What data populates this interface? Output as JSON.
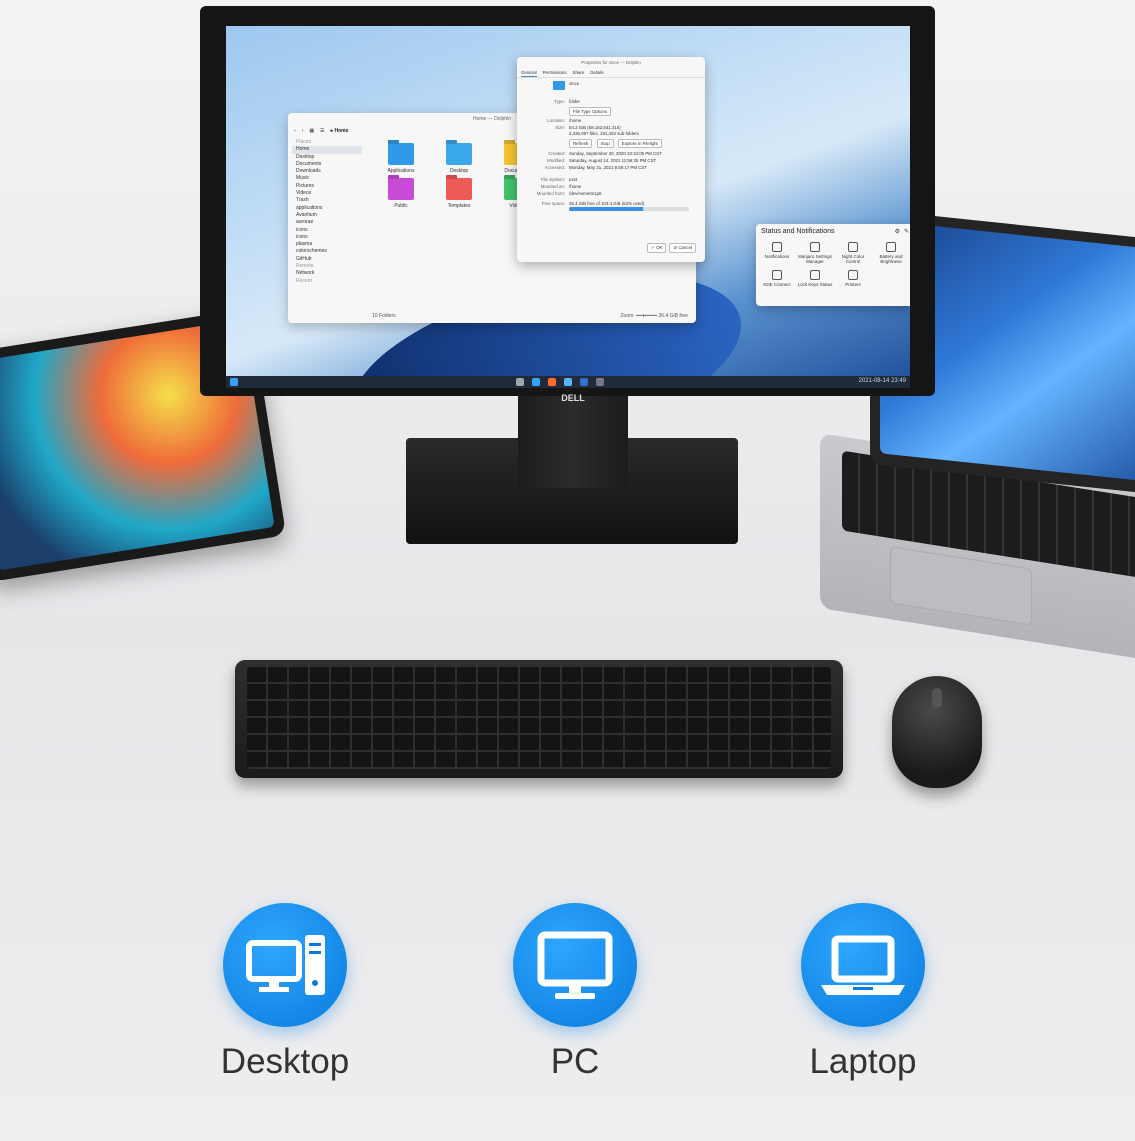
{
  "colors": {
    "accent_blue": "#0a7bdc",
    "badge_blue": "#2ea6ff",
    "keyboard": "#1b1b1b"
  },
  "monitor": {
    "brand": "DELL",
    "dolphin": {
      "title": "Home — Dolphin",
      "breadcrumb": "Home",
      "places_heading": "Places",
      "places": [
        "Home",
        "Desktop",
        "Documents",
        "Downloads",
        "Music",
        "Pictures",
        "Videos",
        "Trash",
        "applications",
        "Avantium",
        "aurorae",
        "icons",
        "icons",
        "plasma",
        "colorschemes",
        "GitHub"
      ],
      "remote_heading": "Remote",
      "remote": [
        "Network"
      ],
      "recent_heading": "Recent",
      "folders": [
        {
          "name": "Applications",
          "color": "#2f9be8"
        },
        {
          "name": "Desktop",
          "color": "#3aa7e9"
        },
        {
          "name": "Documents",
          "color": "#f4c431"
        },
        {
          "name": "Public",
          "color": "#c84bd6"
        },
        {
          "name": "Templates",
          "color": "#ee5a57"
        },
        {
          "name": "Videos",
          "color": "#41c26b"
        }
      ],
      "status": "10 Folders",
      "zoom_label": "Zoom:",
      "free": "36.4 GiB free"
    },
    "properties": {
      "title": "Properties for vince — Dolphin",
      "tabs": [
        "General",
        "Permissions",
        "Share",
        "Details"
      ],
      "name": "vince",
      "type_label": "Type:",
      "type_value": "folder",
      "file_type_options": "File Type Options",
      "location_label": "Location:",
      "location_value": "/home",
      "size_label": "Size:",
      "size_value": "54.2 GiB (58,182,641,415)",
      "size_detail": "2,436,057 files, 191,403 sub-folders",
      "refresh": "Refresh",
      "stop": "Stop",
      "explore": "Explore in Filelight",
      "created_label": "Created:",
      "created_value": "Sunday, September 20, 2020 10:10:05 PM CST",
      "modified_label": "Modified:",
      "modified_value": "Saturday, August 14, 2021 11:56:35 PM CST",
      "accessed_label": "Accessed:",
      "accessed_value": "Monday, May 31, 2021 9:59:17 PM CST",
      "fs_label": "File System:",
      "fs_value": "ext4",
      "mounted_on_label": "Mounted on:",
      "mounted_on_value": "/home",
      "mounted_from_label": "Mounted from:",
      "mounted_from_value": "/dev/nvme0n1p6",
      "free_label": "Free space:",
      "free_value": "36.4 GiB free of 103.4 GiB (62% used)",
      "used_fraction": 0.62,
      "ok": "OK",
      "cancel": "Cancel"
    },
    "notifications": {
      "title": "Status and Notifications",
      "items": [
        "Notifications",
        "Manjaro Settings Manager",
        "Night Color Control",
        "Battery and Brightness",
        "KDE Connect",
        "Lock Keys Status",
        "Printers"
      ]
    },
    "taskbar_clock": "2021-08-14 23:49"
  },
  "devices": [
    {
      "label": "Desktop",
      "icon": "desktop-tower-icon"
    },
    {
      "label": "PC",
      "icon": "monitor-icon"
    },
    {
      "label": "Laptop",
      "icon": "laptop-icon"
    }
  ]
}
